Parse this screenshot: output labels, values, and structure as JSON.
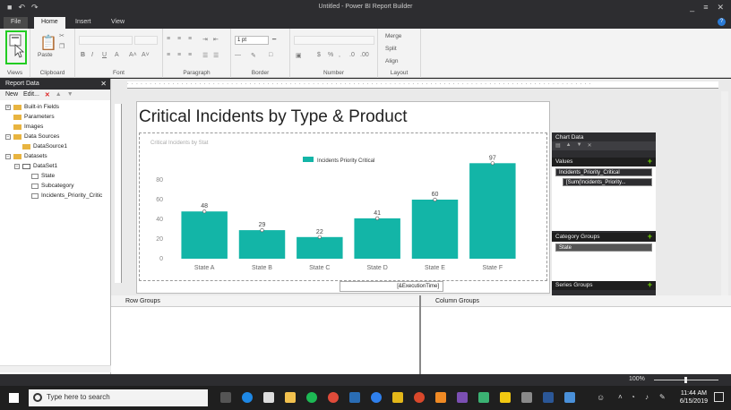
{
  "window": {
    "title": "Untitled - Power BI Report Builder"
  },
  "ribbon": {
    "tabs": [
      "File",
      "Home",
      "Insert",
      "View"
    ],
    "active_tab": "Home",
    "groups": [
      "Views",
      "Clipboard",
      "Font",
      "Paragraph",
      "Border",
      "Number",
      "Layout"
    ],
    "paste_label": "Paste",
    "border_width": "1 pt",
    "merge_label": "Merge",
    "split_label": "Split",
    "align_label": "Align"
  },
  "report_data": {
    "title": "Report Data",
    "new_label": "New",
    "edit_label": "Edit...",
    "tree": [
      {
        "label": "Built-in Fields",
        "indent": 0,
        "expander": "+",
        "kind": "folder"
      },
      {
        "label": "Parameters",
        "indent": 0,
        "expander": "",
        "kind": "folder"
      },
      {
        "label": "Images",
        "indent": 0,
        "expander": "",
        "kind": "folder"
      },
      {
        "label": "Data Sources",
        "indent": 0,
        "expander": "−",
        "kind": "folder"
      },
      {
        "label": "DataSource1",
        "indent": 1,
        "expander": "",
        "kind": "datasource"
      },
      {
        "label": "Datasets",
        "indent": 0,
        "expander": "−",
        "kind": "folder"
      },
      {
        "label": "DataSet1",
        "indent": 1,
        "expander": "−",
        "kind": "dataset"
      },
      {
        "label": "State",
        "indent": 2,
        "expander": "",
        "kind": "field"
      },
      {
        "label": "Subcategory",
        "indent": 2,
        "expander": "",
        "kind": "field"
      },
      {
        "label": "Incidents_Priority_Critic",
        "indent": 2,
        "expander": "",
        "kind": "field"
      }
    ]
  },
  "report": {
    "title": "Critical Incidents by Type & Product",
    "execution_time_placeholder": "[&ExecutionTime]"
  },
  "chart_data": {
    "type": "bar",
    "title": "Critical Incidents by Stat",
    "categories": [
      "State A",
      "State B",
      "State C",
      "State D",
      "State E",
      "State F"
    ],
    "series": [
      {
        "name": "Incidents Priority Critical",
        "values": [
          48,
          29,
          22,
          41,
          60,
          97
        ],
        "color": "#13b5a7"
      }
    ],
    "ylim": [
      0,
      100
    ],
    "yticks": [
      0,
      20,
      40,
      60,
      80
    ],
    "legend_position": "top",
    "grid": false
  },
  "chart_data_panel": {
    "title": "Chart Data",
    "values_label": "Values",
    "value_field": "Incidents_Priority_Critical",
    "value_expression": "[Sum(Incidents_Priority...",
    "category_groups_label": "Category Groups",
    "category_field": "State",
    "series_groups_label": "Series Groups"
  },
  "groupings": {
    "row_groups": "Row Groups",
    "column_groups": "Column Groups"
  },
  "status": {
    "zoom": "100%"
  },
  "taskbar": {
    "search_placeholder": "Type here to search",
    "time": "11:44 AM",
    "date": "6/15/2019"
  }
}
